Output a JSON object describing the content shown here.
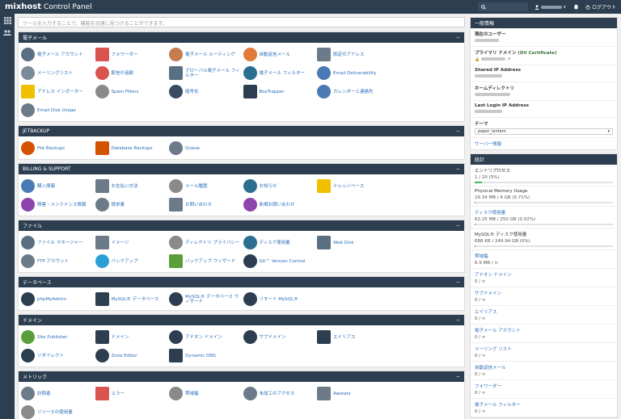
{
  "header": {
    "logo_text": "mixhost",
    "logo_sub": "Control Panel",
    "logout": "ログアウト",
    "search_icon": "search-icon",
    "user_icon": "user-icon",
    "bell_icon": "bell-icon"
  },
  "search": {
    "placeholder": "ツールを入力することで、機能を迅速に見つけることができます。"
  },
  "sections": [
    {
      "title": "電子メール",
      "items": [
        {
          "label": "電子メール アカウント",
          "icon": "mail-account-icon",
          "color": "#5b6f82"
        },
        {
          "label": "フォワーダー",
          "icon": "forwarder-icon",
          "color": "#d9534f"
        },
        {
          "label": "電子メール ルーティング",
          "icon": "routing-icon",
          "color": "#c77b4f"
        },
        {
          "label": "自動返信メール",
          "icon": "autoresponder-icon",
          "color": "#e07b39"
        },
        {
          "label": "既定のアドレス",
          "icon": "default-address-icon",
          "color": "#6c7a89"
        },
        {
          "label": "メーリングリスト",
          "icon": "mailing-list-icon",
          "color": "#7a8a99"
        },
        {
          "label": "配信の追跡",
          "icon": "track-delivery-icon",
          "color": "#d9534f"
        },
        {
          "label": "グローバル電子メール フィルター",
          "icon": "global-filter-icon",
          "color": "#5b6f82"
        },
        {
          "label": "電子メール フィルター",
          "icon": "email-filter-icon",
          "color": "#2c6e8f"
        },
        {
          "label": "Email Deliverability",
          "icon": "deliverability-icon",
          "color": "#4a7ab5"
        },
        {
          "label": "アドレス インポーター",
          "icon": "importer-icon",
          "color": "#f0c000"
        },
        {
          "label": "Spam Filters",
          "icon": "spam-filter-icon",
          "color": "#8a8a8a"
        },
        {
          "label": "暗号化",
          "icon": "encryption-icon",
          "color": "#3a4d60"
        },
        {
          "label": "BoxTrapper",
          "icon": "boxtrapper-icon",
          "color": "#2c3e50"
        },
        {
          "label": "カレンダーと連絡先",
          "icon": "calendar-icon",
          "color": "#4a7ab5"
        },
        {
          "label": "Email Disk Usage",
          "icon": "disk-usage-icon",
          "color": "#6c7a89"
        }
      ]
    },
    {
      "title": "JETBACKUP",
      "items": [
        {
          "label": "File Backups",
          "icon": "file-backup-icon",
          "color": "#d35400"
        },
        {
          "label": "Database Backups",
          "icon": "database-backup-icon",
          "color": "#d35400"
        },
        {
          "label": "Queue",
          "icon": "queue-icon",
          "color": "#6c7a89"
        }
      ]
    },
    {
      "title": "BILLING & SUPPORT",
      "items": [
        {
          "label": "購入情報",
          "icon": "user-info-icon",
          "color": "#4a7ab5"
        },
        {
          "label": "お支払い方法",
          "icon": "payment-icon",
          "color": "#6c7a89"
        },
        {
          "label": "メール履歴",
          "icon": "email-history-icon",
          "color": "#8a8a8a"
        },
        {
          "label": "お知らせ",
          "icon": "announcements-icon",
          "color": "#2c6e8f"
        },
        {
          "label": "ナレッジベース",
          "icon": "knowledge-icon",
          "color": "#f0c000"
        },
        {
          "label": "障害・メンテナンス情報",
          "icon": "maintenance-icon",
          "color": "#8e44ad"
        },
        {
          "label": "請求書",
          "icon": "invoice-icon",
          "color": "#6c7a89"
        },
        {
          "label": "お問い合わせ",
          "icon": "contact-icon",
          "color": "#6c7a89"
        },
        {
          "label": "新規お問い合わせ",
          "icon": "new-ticket-icon",
          "color": "#8e44ad"
        }
      ]
    },
    {
      "title": "ファイル",
      "items": [
        {
          "label": "ファイル マネージャー",
          "icon": "file-manager-icon",
          "color": "#5b6f82"
        },
        {
          "label": "イメージ",
          "icon": "images-icon",
          "color": "#6c7a89"
        },
        {
          "label": "ディレクトリ プライバシー",
          "icon": "privacy-icon",
          "color": "#8a8a8a"
        },
        {
          "label": "ディスク使用量",
          "icon": "disk-icon",
          "color": "#2c6e8f"
        },
        {
          "label": "Web Disk",
          "icon": "web-disk-icon",
          "color": "#5b6f82"
        },
        {
          "label": "FTP アカウント",
          "icon": "ftp-icon",
          "color": "#6c7a89"
        },
        {
          "label": "バックアップ",
          "icon": "backup-icon",
          "color": "#2a9fd6"
        },
        {
          "label": "バックアップ ウィザード",
          "icon": "backup-wizard-icon",
          "color": "#5a9e3a"
        },
        {
          "label": "Git™ Version Control",
          "icon": "git-icon",
          "color": "#2c3e50"
        }
      ]
    },
    {
      "title": "データベース",
      "items": [
        {
          "label": "phpMyAdmin",
          "icon": "phpmyadmin-icon",
          "color": "#2c3e50"
        },
        {
          "label": "MySQL® データベース",
          "icon": "mysql-icon",
          "color": "#2c3e50"
        },
        {
          "label": "MySQL® データベース ウィザード",
          "icon": "mysql-wizard-icon",
          "color": "#2c3e50"
        },
        {
          "label": "リモート MySQL®",
          "icon": "remote-mysql-icon",
          "color": "#2c3e50"
        }
      ]
    },
    {
      "title": "ドメイン",
      "items": [
        {
          "label": "Site Publisher",
          "icon": "site-publisher-icon",
          "color": "#5a9e3a"
        },
        {
          "label": "ドメイン",
          "icon": "domains-icon",
          "color": "#2c3e50"
        },
        {
          "label": "アドオン ドメイン",
          "icon": "addon-domain-icon",
          "color": "#2c3e50"
        },
        {
          "label": "サブドメイン",
          "icon": "subdomain-icon",
          "color": "#2c3e50"
        },
        {
          "label": "エイリアス",
          "icon": "alias-icon",
          "color": "#2c3e50"
        },
        {
          "label": "リダイレクト",
          "icon": "redirect-icon",
          "color": "#2c3e50"
        },
        {
          "label": "Zone Editor",
          "icon": "zone-editor-icon",
          "color": "#2c3e50"
        },
        {
          "label": "Dynamic DNS",
          "icon": "dynamic-dns-icon",
          "color": "#2c3e50"
        }
      ]
    },
    {
      "title": "メトリック",
      "items": [
        {
          "label": "訪問者",
          "icon": "visitors-icon",
          "color": "#6c7a89"
        },
        {
          "label": "エラー",
          "icon": "errors-icon",
          "color": "#d9534f"
        },
        {
          "label": "帯域幅",
          "icon": "bandwidth-icon",
          "color": "#8a8a8a"
        },
        {
          "label": "未加工のアクセス",
          "icon": "raw-access-icon",
          "color": "#6c7a89"
        },
        {
          "label": "Awstats",
          "icon": "awstats-icon",
          "color": "#6c7a89"
        },
        {
          "label": "リソースの使用量",
          "icon": "resource-usage-icon",
          "color": "#8a8a8a"
        }
      ]
    }
  ],
  "general": {
    "title": "一般情報",
    "current_user_label": "現在のユーザー",
    "primary_domain_label": "プライマリ ドメイン",
    "primary_domain_cert": "(DV Certificate)",
    "shared_ip_label": "Shared IP Address",
    "home_dir_label": "ホームディレクトリ",
    "last_login_label": "Last Login IP Address",
    "theme_label": "テーマ",
    "theme_value": "paper_lantern",
    "server_info": "サーバー情報"
  },
  "stats": {
    "title": "統計",
    "rows": [
      {
        "label": "エントリプロセス",
        "value": "1 / 20 (5%)",
        "progress": 5,
        "link": false
      },
      {
        "label": "Physical Memory Usage",
        "value": "29.34 MB / 4 GB (0.71%)",
        "progress": 0.71,
        "link": false
      },
      {
        "label": "ディスク使用量",
        "value": "62.25 MB / 250 GB (0.02%)",
        "progress": 0.02,
        "link": true
      },
      {
        "label": "MySQL® ディスク使用量",
        "value": "688 KB / 249.94 GB (0%)",
        "progress": 0,
        "link": false
      },
      {
        "label": "帯域幅",
        "value": "6.9 MB / ∞",
        "link": true
      },
      {
        "label": "アドオン ドメイン",
        "value": "0 / ∞",
        "link": true
      },
      {
        "label": "サブドメイン",
        "value": "0 / ∞",
        "link": true
      },
      {
        "label": "エイリアス",
        "value": "0 / ∞",
        "link": true
      },
      {
        "label": "電子メール アカウント",
        "value": "0 / ∞",
        "link": true
      },
      {
        "label": "メーリング リスト",
        "value": "0 / ∞",
        "link": true
      },
      {
        "label": "自動返信メール",
        "value": "0 / ∞",
        "link": true
      },
      {
        "label": "フォワーダー",
        "value": "0 / ∞",
        "link": true
      },
      {
        "label": "電子メール フィルター",
        "value": "0 / ∞",
        "link": true
      }
    ]
  }
}
